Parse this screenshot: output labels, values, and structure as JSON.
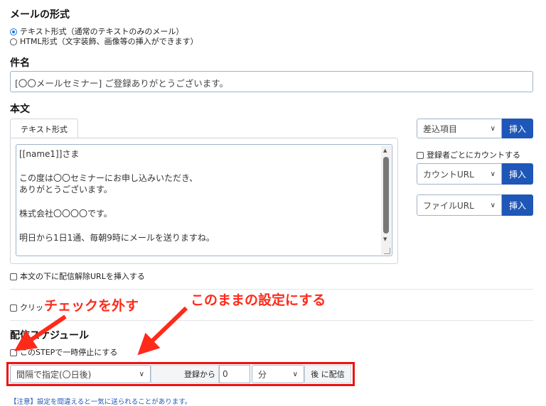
{
  "format": {
    "title": "メールの形式",
    "option_text": "テキスト形式（通常のテキストのみのメール）",
    "option_html": "HTML形式（文字装飾、画像等の挿入ができます）"
  },
  "subject": {
    "title": "件名",
    "value": "[〇〇メールセミナー] ご登録ありがとうございます。"
  },
  "body": {
    "title": "本文",
    "tab": "テキスト形式",
    "lines": [
      "[[name1]]さま",
      "",
      "この度は〇〇セミナーにお申し込みいただき、",
      "ありがとうございます。",
      "",
      "株式会社〇〇〇〇です。",
      "",
      "明日から1日1通、毎朝9時にメールを送りますね。"
    ],
    "unsubscribe_label": "本文の下に配信解除URLを挿入する",
    "click_label": "クリッ"
  },
  "side": {
    "merge_select": "差込項目",
    "insert": "挿入",
    "count_label": "登録者ごとにカウントする",
    "count_select": "カウントURL",
    "file_select": "ファイルURL"
  },
  "schedule": {
    "title": "配信スケジュール",
    "pause_label": "このSTEPで一時停止にする",
    "interval_select": "間隔で指定(〇日後)",
    "from_label": "登録から",
    "amount": "0",
    "unit_select": "分",
    "after_label": "後 に配信",
    "note": "【注意】設定を間違えると一気に送られることがあります。"
  },
  "annotations": {
    "uncheck": "チェックを外す",
    "keep": "このままの設定にする"
  },
  "colors": {
    "accent": "#1f57b8",
    "annotation": "#ff2a1a"
  }
}
